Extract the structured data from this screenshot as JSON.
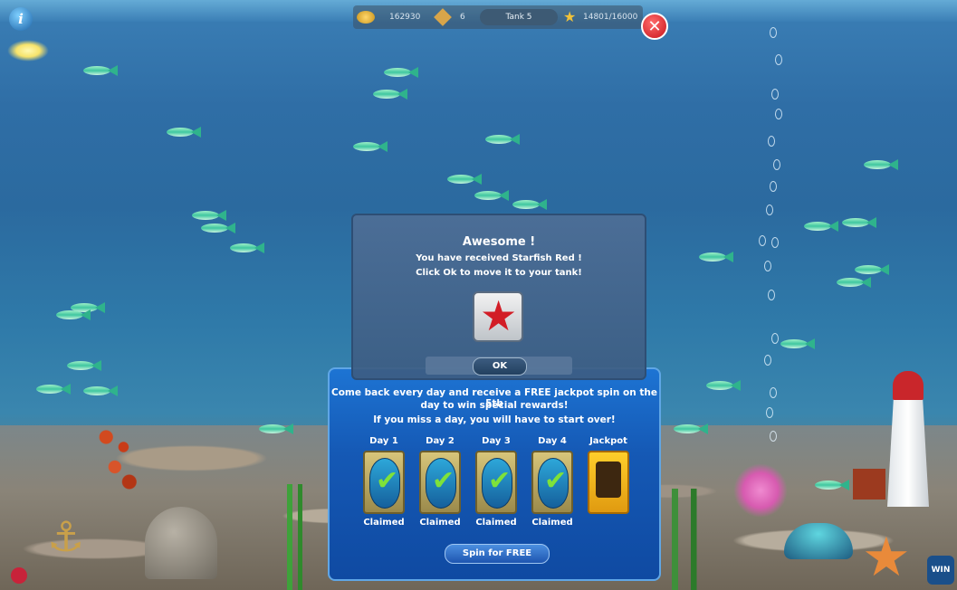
{
  "hud": {
    "coins": "162930",
    "gems": "6",
    "tank": "Tank 5",
    "xp": "14801/16000"
  },
  "award": {
    "title": "Awesome !",
    "line1": "You have received Starfish Red !",
    "line2": "Click Ok to move it to your tank!",
    "ok_label": "OK"
  },
  "reward": {
    "message_line1": "Come back every day and receive a FREE jackpot spin on the 5th",
    "message_line2": "day to win special rewards!",
    "message_line3": "If you miss a day, you will have to start over!",
    "days": [
      {
        "label": "Day 1",
        "status": "Claimed"
      },
      {
        "label": "Day 2",
        "status": "Claimed"
      },
      {
        "label": "Day 3",
        "status": "Claimed"
      },
      {
        "label": "Day 4",
        "status": "Claimed"
      },
      {
        "label": "Jackpot",
        "status": ""
      }
    ],
    "spin_label": "Spin for FREE"
  },
  "decor": {
    "win_badge": "WIN"
  },
  "colors": {
    "ocean": "#2b6a9f",
    "panel_blue": "#1559b5",
    "dialog": "#4e6e96",
    "check_green": "#7ee23a",
    "close_red": "#c8141b"
  }
}
